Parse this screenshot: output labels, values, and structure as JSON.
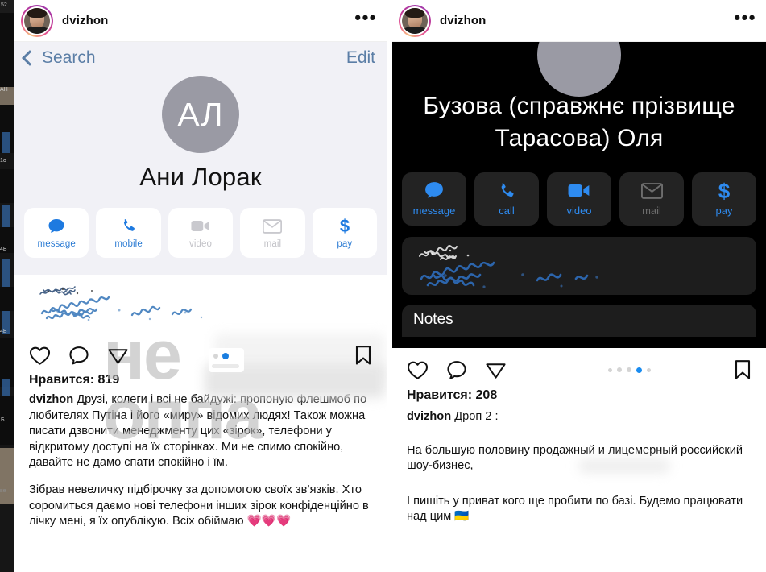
{
  "left_post": {
    "header": {
      "username": "dvizhon",
      "avatar_name": "dvizhon-avatar",
      "more_label": "•••"
    },
    "contact_sheet": {
      "back_label": "Search",
      "edit_label": "Edit",
      "monogram": "АЛ",
      "contact_name": "Ани Лорак",
      "actions": [
        {
          "id": "message",
          "label": "message",
          "icon": "message-bubble-icon",
          "enabled": true
        },
        {
          "id": "mobile",
          "label": "mobile",
          "icon": "phone-icon",
          "enabled": true
        },
        {
          "id": "video",
          "label": "video",
          "icon": "video-camera-icon",
          "enabled": false
        },
        {
          "id": "mail",
          "label": "mail",
          "icon": "envelope-icon",
          "enabled": false
        },
        {
          "id": "pay",
          "label": "pay",
          "icon": "dollar-sign-icon",
          "enabled": true
        }
      ],
      "redacted_note": "обфусковані контактні дані"
    },
    "actions": {
      "like": "heart-icon",
      "comment": "comment-bubble-icon",
      "share": "paper-plane-icon",
      "save": "bookmark-icon"
    },
    "likes_text": "Нравится: 819",
    "watermark_text": "не оппа",
    "caption": {
      "username": "dvizhon",
      "paragraphs": [
        "Друзі, колеги і всі не байдужі: пропоную флешмоб по любителях Путіна і його «миру» відомих людях! Також можна писати дзвонити менеджменту цих «зірок», телефони у відкритому доступі на їх сторінках. Ми не спимо спокійно, давайте не дамо спати спокійно і їм.",
        "Зібрав невеличку підбірочку за допомогою своїх зв’язків. Хто соромиться даємо нові телефони інших зірок конфіденційно в лічку мені, я їх опублікую. Всіх обіймаю 💗💗💗"
      ]
    }
  },
  "right_post": {
    "header": {
      "username": "dvizhon",
      "avatar_name": "dvizhon-avatar",
      "more_label": "•••"
    },
    "contact_sheet": {
      "contact_name": "Бузова (справжнє прізвище Тарасова) Оля",
      "actions": [
        {
          "id": "message",
          "label": "message",
          "icon": "message-bubble-icon",
          "enabled": true
        },
        {
          "id": "call",
          "label": "call",
          "icon": "phone-icon",
          "enabled": true
        },
        {
          "id": "video",
          "label": "video",
          "icon": "video-camera-icon",
          "enabled": true
        },
        {
          "id": "mail",
          "label": "mail",
          "icon": "envelope-icon",
          "enabled": false
        },
        {
          "id": "pay",
          "label": "pay",
          "icon": "dollar-sign-icon",
          "enabled": true
        }
      ],
      "notes_label": "Notes"
    },
    "actions": {
      "like": "heart-icon",
      "comment": "comment-bubble-icon",
      "share": "paper-plane-icon",
      "save": "bookmark-icon"
    },
    "carousel": {
      "count": 5,
      "active_index": 3
    },
    "likes_text": "Нравится: 208",
    "caption": {
      "username": "dvizhon",
      "title": "Дроп 2 :",
      "paragraphs": [
        "На большую половину продажный и лицемерный российский шоу-бизнес,",
        "І пишіть у приват кого ще пробити по базі. Будемо працювати над цим 🇺🇦"
      ]
    }
  },
  "colors": {
    "ig_blue": "#2e8bf0",
    "ios_blue": "#2e7dd4",
    "link_grey_blue": "#5b7ea6",
    "contact_bg": "#f1f1f6",
    "dark_bg": "#000000",
    "dark_tile": "#232323",
    "mono_grey": "#9a9aa4",
    "watermark_grey": "#b9b9b9"
  }
}
